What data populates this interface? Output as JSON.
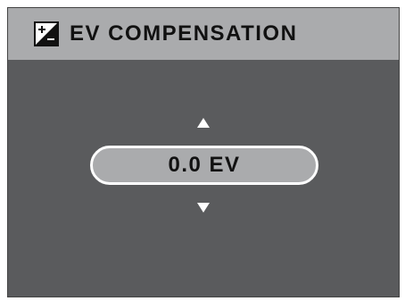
{
  "header": {
    "title": "EV COMPENSATION",
    "icon": "ev-compensation-icon"
  },
  "control": {
    "value": "0.0 EV",
    "up_icon": "triangle-up-icon",
    "down_icon": "triangle-down-icon"
  },
  "colors": {
    "screen_background": "#5a5b5d",
    "title_bar": "#aaabad",
    "value_box": "#aaabad",
    "highlight": "#ffffff"
  }
}
